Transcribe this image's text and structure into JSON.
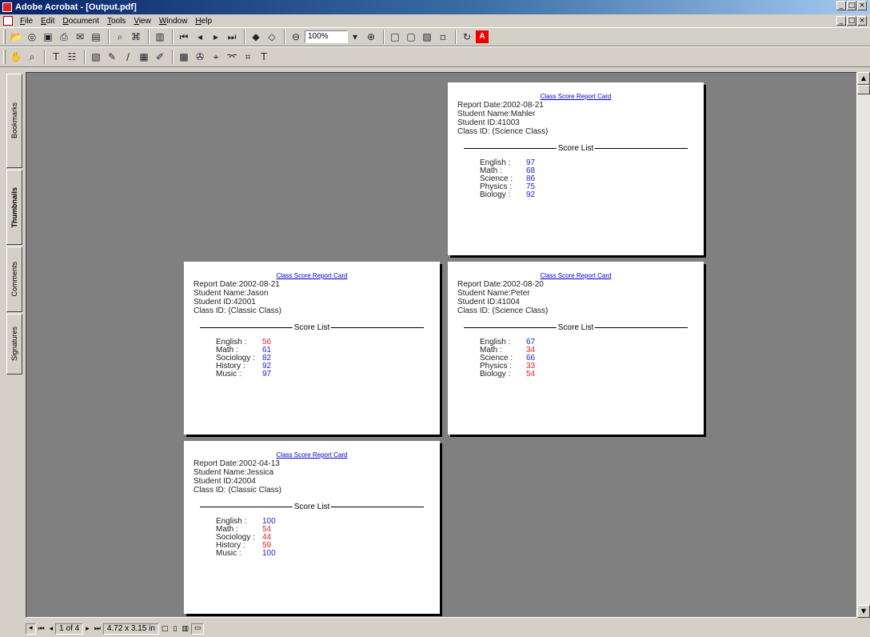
{
  "window": {
    "title": "Adobe Acrobat - [Output.pdf]",
    "controls": [
      "_",
      "□",
      "×"
    ]
  },
  "menu": [
    "File",
    "Edit",
    "Document",
    "Tools",
    "View",
    "Window",
    "Help"
  ],
  "toolbar": {
    "zoom": "100%"
  },
  "side_tabs": [
    "Bookmarks",
    "Thumbnails",
    "Comments",
    "Signatures"
  ],
  "pages": [
    {
      "title": "Class Score Report Card",
      "report_date": "Report Date:2002-08-21",
      "student_name": "Student Name:Mahler",
      "student_id": "Student ID:41003",
      "class_id": "Class ID: (Science Class)",
      "score_list_label": "Score List",
      "scores": [
        {
          "subject": "English :",
          "value": "97",
          "color": "#2222dd"
        },
        {
          "subject": "Math :",
          "value": "68",
          "color": "#2222dd"
        },
        {
          "subject": "Science :",
          "value": "86",
          "color": "#2222dd"
        },
        {
          "subject": "Physics :",
          "value": "75",
          "color": "#2222dd"
        },
        {
          "subject": "Biology :",
          "value": "92",
          "color": "#2222dd"
        }
      ]
    },
    {
      "title": "Class Score Report Card",
      "report_date": "Report Date:2002-08-21",
      "student_name": "Student Name:Jason",
      "student_id": "Student ID:42001",
      "class_id": "Class ID: (Classic Class)",
      "score_list_label": "Score List",
      "scores": [
        {
          "subject": "English :",
          "value": "56",
          "color": "#dd2222"
        },
        {
          "subject": "Math :",
          "value": "61",
          "color": "#2222dd"
        },
        {
          "subject": "Sociology :",
          "value": "82",
          "color": "#2222dd"
        },
        {
          "subject": "History :",
          "value": "92",
          "color": "#2222dd"
        },
        {
          "subject": "Music :",
          "value": "97",
          "color": "#2222dd"
        }
      ]
    },
    {
      "title": "Class Score Report Card",
      "report_date": "Report Date:2002-08-20",
      "student_name": "Student Name:Peter",
      "student_id": "Student ID:41004",
      "class_id": "Class ID: (Science Class)",
      "score_list_label": "Score List",
      "scores": [
        {
          "subject": "English :",
          "value": "67",
          "color": "#2222dd"
        },
        {
          "subject": "Math :",
          "value": "34",
          "color": "#dd2222"
        },
        {
          "subject": "Science :",
          "value": "66",
          "color": "#2222dd"
        },
        {
          "subject": "Physics :",
          "value": "33",
          "color": "#dd2222"
        },
        {
          "subject": "Biology :",
          "value": "54",
          "color": "#dd2222"
        }
      ]
    },
    {
      "title": "Class Score Report Card",
      "report_date": "Report Date:2002-04-13",
      "student_name": "Student Name:Jessica",
      "student_id": "Student ID:42004",
      "class_id": "Class ID: (Classic Class)",
      "score_list_label": "Score List",
      "scores": [
        {
          "subject": "English :",
          "value": "100",
          "color": "#2222dd"
        },
        {
          "subject": "Math :",
          "value": "54",
          "color": "#dd2222"
        },
        {
          "subject": "Sociology :",
          "value": "44",
          "color": "#dd2222"
        },
        {
          "subject": "History :",
          "value": "59",
          "color": "#dd2222"
        },
        {
          "subject": "Music :",
          "value": "100",
          "color": "#2222dd"
        }
      ]
    }
  ],
  "status": {
    "page_indicator": "1 of 4",
    "page_size": "4.72 x 3.15 in"
  }
}
